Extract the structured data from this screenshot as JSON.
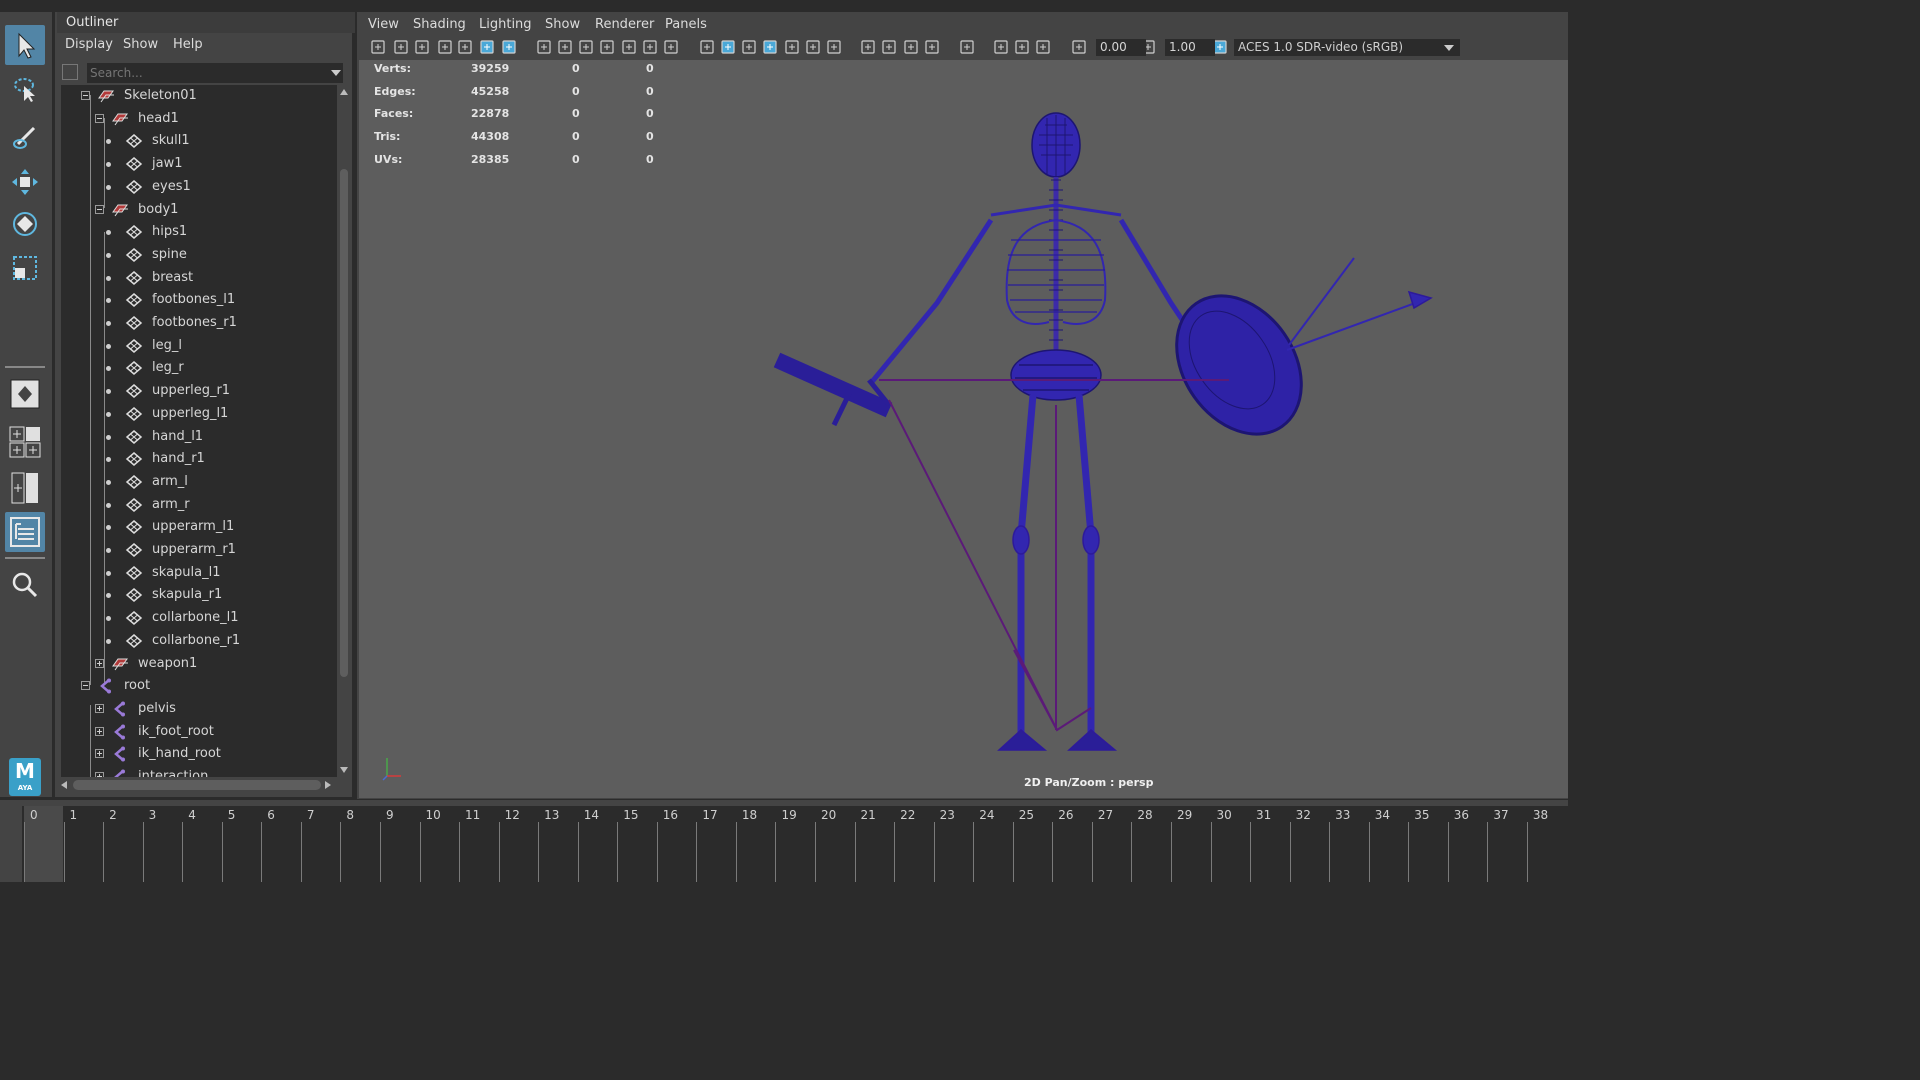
{
  "outliner": {
    "title": "Outliner",
    "menu": [
      "Display",
      "Show",
      "Help"
    ],
    "search_placeholder": "Search...",
    "tree": [
      {
        "label": "Skeleton01",
        "icon": "group-icon",
        "expander": "minus",
        "level": 0
      },
      {
        "label": "head1",
        "icon": "group-icon",
        "expander": "minus",
        "level": 1
      },
      {
        "label": "skull1",
        "icon": "mesh-icon",
        "level": 2
      },
      {
        "label": "jaw1",
        "icon": "mesh-icon",
        "level": 2
      },
      {
        "label": "eyes1",
        "icon": "mesh-icon",
        "level": 2
      },
      {
        "label": "body1",
        "icon": "group-icon",
        "expander": "minus",
        "level": 1
      },
      {
        "label": "hips1",
        "icon": "mesh-icon",
        "level": 2
      },
      {
        "label": "spine",
        "icon": "mesh-icon",
        "level": 2
      },
      {
        "label": "breast",
        "icon": "mesh-icon",
        "level": 2
      },
      {
        "label": "footbones_l1",
        "icon": "mesh-icon",
        "level": 2
      },
      {
        "label": "footbones_r1",
        "icon": "mesh-icon",
        "level": 2
      },
      {
        "label": "leg_l",
        "icon": "mesh-icon",
        "level": 2
      },
      {
        "label": "leg_r",
        "icon": "mesh-icon",
        "level": 2
      },
      {
        "label": "upperleg_r1",
        "icon": "mesh-icon",
        "level": 2
      },
      {
        "label": "upperleg_l1",
        "icon": "mesh-icon",
        "level": 2
      },
      {
        "label": "hand_l1",
        "icon": "mesh-icon",
        "level": 2
      },
      {
        "label": "hand_r1",
        "icon": "mesh-icon",
        "level": 2
      },
      {
        "label": "arm_l",
        "icon": "mesh-icon",
        "level": 2
      },
      {
        "label": "arm_r",
        "icon": "mesh-icon",
        "level": 2
      },
      {
        "label": "upperarm_l1",
        "icon": "mesh-icon",
        "level": 2
      },
      {
        "label": "upperarm_r1",
        "icon": "mesh-icon",
        "level": 2
      },
      {
        "label": "skapula_l1",
        "icon": "mesh-icon",
        "level": 2
      },
      {
        "label": "skapula_r1",
        "icon": "mesh-icon",
        "level": 2
      },
      {
        "label": "collarbone_l1",
        "icon": "mesh-icon",
        "level": 2
      },
      {
        "label": "collarbone_r1",
        "icon": "mesh-icon",
        "level": 2
      },
      {
        "label": "weapon1",
        "icon": "group-icon",
        "expander": "plus",
        "level": 1
      },
      {
        "label": "root",
        "icon": "joint-icon",
        "expander": "minus",
        "level": 0
      },
      {
        "label": "pelvis",
        "icon": "joint-icon",
        "expander": "plus",
        "level": 1
      },
      {
        "label": "ik_foot_root",
        "icon": "joint-icon",
        "expander": "plus",
        "level": 1
      },
      {
        "label": "ik_hand_root",
        "icon": "joint-icon",
        "expander": "plus",
        "level": 1
      },
      {
        "label": "interaction",
        "icon": "joint-icon",
        "expander": "plus",
        "level": 1
      }
    ]
  },
  "viewport": {
    "menu": [
      "View",
      "Shading",
      "Lighting",
      "Show",
      "Renderer",
      "Panels"
    ],
    "exposure_value": "0.00",
    "gamma_value": "1.00",
    "color_space": "ACES 1.0 SDR-video (sRGB)",
    "camera_label": "2D Pan/Zoom : persp",
    "hud_stats": [
      {
        "label": "Verts:",
        "v1": "39259",
        "v2": "0",
        "v3": "0"
      },
      {
        "label": "Edges:",
        "v1": "45258",
        "v2": "0",
        "v3": "0"
      },
      {
        "label": "Faces:",
        "v1": "22878",
        "v2": "0",
        "v3": "0"
      },
      {
        "label": "Tris:",
        "v1": "44308",
        "v2": "0",
        "v3": "0"
      },
      {
        "label": "UVs:",
        "v1": "28385",
        "v2": "0",
        "v3": "0"
      }
    ]
  },
  "toolbox": {
    "logo_text": "M",
    "logo_subtext": "AYA"
  },
  "timeline": {
    "frames": [
      "0",
      "1",
      "2",
      "3",
      "4",
      "5",
      "6",
      "7",
      "8",
      "9",
      "10",
      "11",
      "12",
      "13",
      "14",
      "15",
      "16",
      "17",
      "18",
      "19",
      "20",
      "21",
      "22",
      "23",
      "24",
      "25",
      "26",
      "27",
      "28",
      "29",
      "30",
      "31",
      "32",
      "33",
      "34",
      "35",
      "36",
      "37",
      "38"
    ],
    "current_frame": "0"
  },
  "colors": {
    "wire": "#1e1a8c",
    "joint": "#5a1a6e",
    "active_tool": "#5285a6"
  }
}
